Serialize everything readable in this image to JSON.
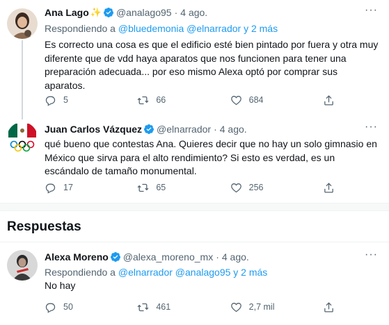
{
  "tweets": [
    {
      "name": "Ana Lago",
      "emoji": "✨",
      "handle": "@analago95",
      "sep": "·",
      "date": "4 ago.",
      "reply_prefix": "Respondiendo a",
      "reply_targets": "@bluedemonia @elnarrador y 2 más",
      "text": "Es correcto una cosa es que el edificio esté bien pintado por fuera y otra muy diferente que de vdd haya aparatos que nos funcionen para tener una preparación adecuada... por eso mismo Alexa optó por comprar sus aparatos.",
      "replies": "5",
      "retweets": "66",
      "likes": "684"
    },
    {
      "name": "Juan Carlos Vázquez",
      "handle": "@elnarrador",
      "sep": "·",
      "date": "4 ago.",
      "text": "qué bueno que contestas Ana. Quieres decir que no hay un solo gimnasio en México que sirva para el alto rendimiento? Si esto es verdad, es un escándalo de tamaño monumental.",
      "replies": "17",
      "retweets": "65",
      "likes": "256"
    },
    {
      "name": "Alexa Moreno",
      "handle": "@alexa_moreno_mx",
      "sep": "·",
      "date": "4 ago.",
      "reply_prefix": "Respondiendo a",
      "reply_targets": "@elnarrador @analago95 y 2 más",
      "text": "No hay",
      "replies": "50",
      "retweets": "461",
      "likes": "2,7 mil"
    }
  ],
  "section_title": "Respuestas",
  "more_label": "···",
  "colors": {
    "accent": "#1d9bf0",
    "secondary_text": "#536471",
    "primary_text": "#0f1419"
  },
  "icons": [
    "more-icon",
    "verified-badge-icon",
    "reply-icon",
    "retweet-icon",
    "like-icon",
    "share-icon"
  ]
}
